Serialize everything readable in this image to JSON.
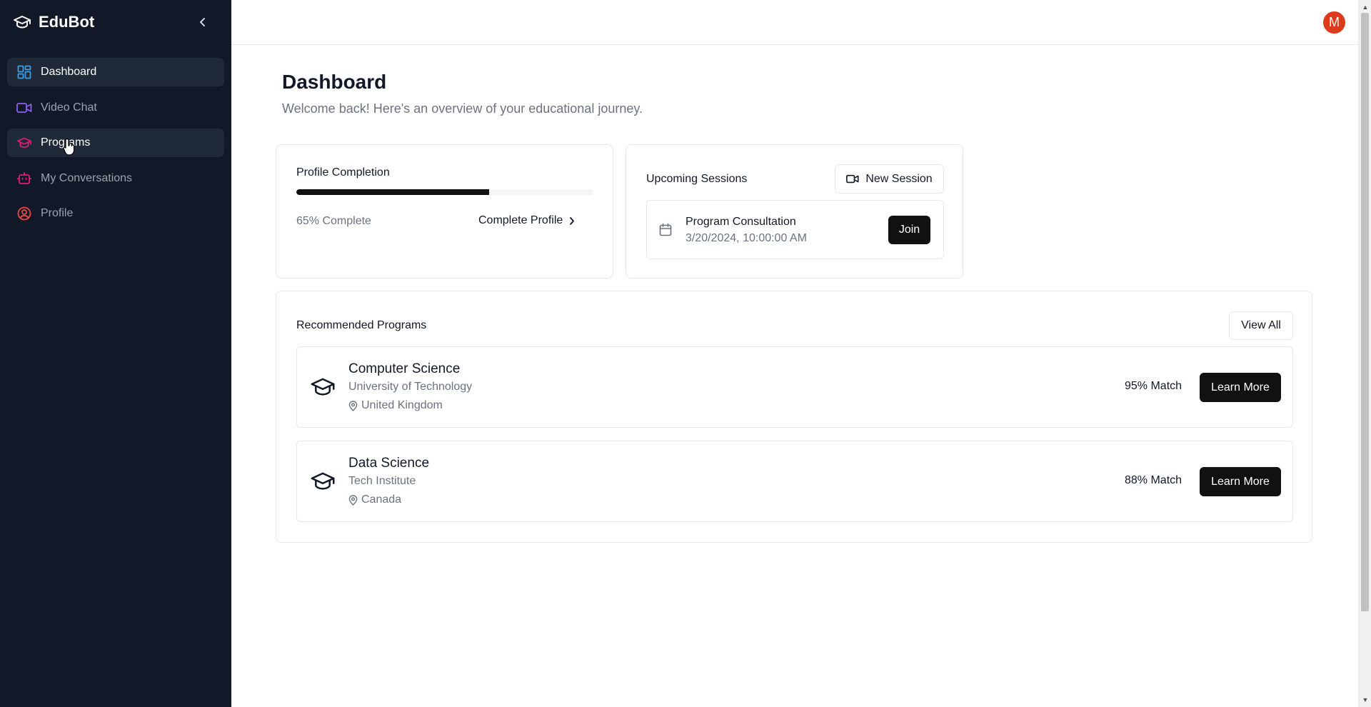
{
  "app": {
    "name": "EduBot"
  },
  "sidebar": {
    "items": [
      {
        "label": "Dashboard",
        "icon": "dashboard-grid-icon",
        "color": "#3b9de6",
        "state": "active"
      },
      {
        "label": "Video Chat",
        "icon": "video-camera-icon",
        "color": "#8b5cf6",
        "state": ""
      },
      {
        "label": "Programs",
        "icon": "graduation-cap-icon",
        "color": "#e11d74",
        "state": "hover"
      },
      {
        "label": "My Conversations",
        "icon": "bot-icon",
        "color": "#e11d74",
        "state": ""
      },
      {
        "label": "Profile",
        "icon": "user-circle-icon",
        "color": "#ef4444",
        "state": ""
      }
    ]
  },
  "header": {
    "avatar_initial": "M",
    "avatar_color": "#dc3a1a"
  },
  "main": {
    "title": "Dashboard",
    "subtitle": "Welcome back! Here's an overview of your educational journey."
  },
  "profile_completion": {
    "title": "Profile Completion",
    "progress": 0.65,
    "progress_text": "65% Complete",
    "action_label": "Complete Profile"
  },
  "sessions": {
    "title": "Upcoming Sessions",
    "new_session_label": "New Session",
    "items": [
      {
        "name": "Program Consultation",
        "time": "3/20/2024, 10:00:00 AM",
        "action_label": "Join"
      }
    ]
  },
  "programs": {
    "title": "Recommended Programs",
    "view_all_label": "View All",
    "items": [
      {
        "name": "Computer Science",
        "institution": "University of Technology",
        "location": "United Kingdom",
        "match": "95% Match",
        "action_label": "Learn More"
      },
      {
        "name": "Data Science",
        "institution": "Tech Institute",
        "location": "Canada",
        "match": "88% Match",
        "action_label": "Learn More"
      }
    ]
  }
}
